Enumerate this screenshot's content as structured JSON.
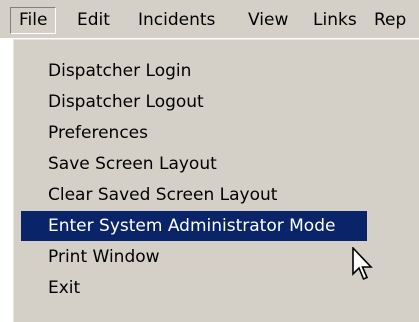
{
  "menubar": {
    "items": [
      {
        "label": "File"
      },
      {
        "label": "Edit"
      },
      {
        "label": "Incidents"
      },
      {
        "label": "View"
      },
      {
        "label": "Links"
      },
      {
        "label": "Rep"
      }
    ]
  },
  "file_menu": {
    "items": [
      {
        "label": "Dispatcher Login"
      },
      {
        "label": "Dispatcher Logout"
      },
      {
        "label": "Preferences"
      },
      {
        "label": "Save Screen Layout"
      },
      {
        "label": "Clear Saved Screen Layout"
      },
      {
        "label": "Enter System Administrator Mode",
        "highlighted": true
      },
      {
        "label": "Print Window"
      },
      {
        "label": "Exit"
      }
    ]
  },
  "cursor": {
    "icon": "arrow-pointer-icon"
  },
  "colors": {
    "menu_background": "#d4d0c8",
    "highlight_background": "#0a246a",
    "highlight_text": "#ffffff"
  }
}
